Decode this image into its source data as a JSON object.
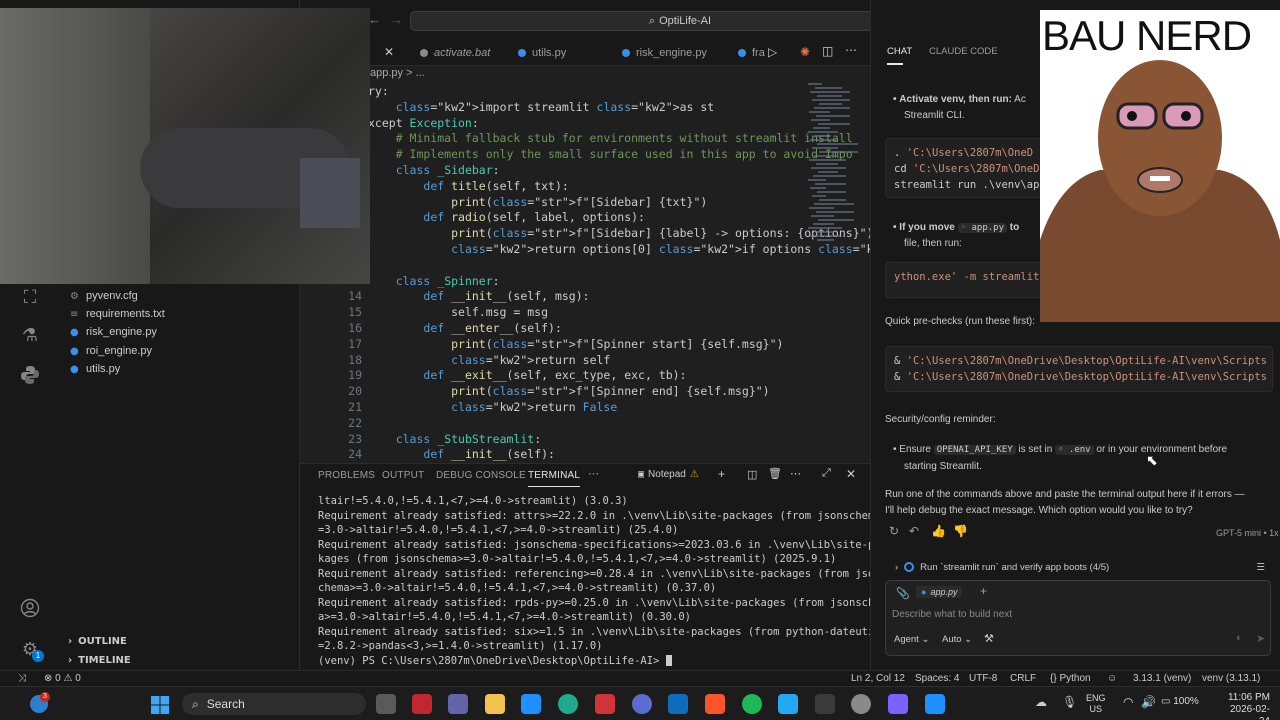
{
  "window": {
    "search_label": "OptiLife-AI",
    "breadcrumb": "app.py  > ..."
  },
  "tabs": [
    {
      "label": "activate.bat",
      "color": "#8a8a8a"
    },
    {
      "label": "utils.py",
      "color": "#3b8eea"
    },
    {
      "label": "risk_engine.py",
      "color": "#3b8eea"
    },
    {
      "label": "fra",
      "color": "#3b8eea"
    }
  ],
  "explorer": {
    "files": [
      "pyvenv.cfg",
      "requirements.txt",
      "risk_engine.py",
      "roi_engine.py",
      "utils.py"
    ],
    "outline": "OUTLINE",
    "timeline": "TIMELINE"
  },
  "editor": {
    "line_numbers": [
      "14",
      "15",
      "16",
      "17",
      "18",
      "19",
      "20",
      "21",
      "22",
      "23",
      "24"
    ],
    "lines": [
      "ry:",
      "    import streamlit as st",
      "xcept Exception:",
      "    # Minimal fallback stub for environments without streamlit install",
      "    # Implements only the small surface used in this app to avoid Impo",
      "    class _Sidebar:",
      "        def title(self, txt):",
      "            print(f\"[Sidebar] {txt}\")",
      "        def radio(self, label, options):",
      "            print(f\"[Sidebar] {label} -> options: {options}\")",
      "            return options[0] if options else None",
      "",
      "    class _Spinner:",
      "        def __init__(self, msg):",
      "            self.msg = msg",
      "        def __enter__(self):",
      "            print(f\"[Spinner start] {self.msg}\")",
      "            return self",
      "        def __exit__(self, exc_type, exc, tb):",
      "            print(f\"[Spinner end] {self.msg}\")",
      "            return False",
      "",
      "    class _StubStreamlit:",
      "        def __init__(self):"
    ]
  },
  "panel": {
    "tabs": [
      "PROBLEMS",
      "OUTPUT",
      "DEBUG CONSOLE",
      "TERMINAL"
    ],
    "active_tab": "TERMINAL",
    "terminal_name": "Notepad",
    "lines": [
      "ltair!=5.4.0,!=5.4.1,<7,>=4.0->streamlit) (3.0.3)",
      "Requirement already satisfied: attrs>=22.2.0 in .\\venv\\Lib\\site-packages (from jsonschema>",
      "=3.0->altair!=5.4.0,!=5.4.1,<7,>=4.0->streamlit) (25.4.0)",
      "Requirement already satisfied: jsonschema-specifications>=2023.03.6 in .\\venv\\Lib\\site-pac",
      "kages (from jsonschema>=3.0->altair!=5.4.0,!=5.4.1,<7,>=4.0->streamlit) (2025.9.1)",
      "Requirement already satisfied: referencing>=0.28.4 in .\\venv\\Lib\\site-packages (from jsons",
      "chema>=3.0->altair!=5.4.0,!=5.4.1,<7,>=4.0->streamlit) (0.37.0)",
      "Requirement already satisfied: rpds-py>=0.25.0 in .\\venv\\Lib\\site-packages (from jsonschem",
      "a>=3.0->altair!=5.4.0,!=5.4.1,<7,>=4.0->streamlit) (0.30.0)",
      "Requirement already satisfied: six>=1.5 in .\\venv\\Lib\\site-packages (from python-dateutil>",
      "=2.8.2->pandas<3,>=1.4.0->streamlit) (1.17.0)",
      "(venv) PS C:\\Users\\2807m\\OneDrive\\Desktop\\OptiLife-AI> "
    ]
  },
  "chat": {
    "tabs": [
      "CHAT",
      "CLAUDE CODE"
    ],
    "bullet1_bold": "Activate venv, then run:",
    "bullet1_rest": " Ac",
    "bullet1_line2": "Streamlit CLI.",
    "code1": [
      ". 'C:\\Users\\2807m\\OneD",
      "cd 'C:\\Users\\2807m\\OneD",
      "streamlit run .\\venv\\app"
    ],
    "bullet2_bold": "If you move",
    "bullet2_file": "app.py",
    "bullet2_rest": "to",
    "bullet2_line2": "file, then run:",
    "code2": "ython.exe' -m streamlit",
    "prechecks": "Quick pre-checks (run these first):",
    "code3": [
      "& 'C:\\Users\\2807m\\OneDrive\\Desktop\\OptiLife-AI\\venv\\Scripts",
      "& 'C:\\Users\\2807m\\OneDrive\\Desktop\\OptiLife-AI\\venv\\Scripts"
    ],
    "security": "Security/config reminder:",
    "ensure": "Ensure",
    "api_key": "OPENAI_API_KEY",
    "is_set_in": "is set in",
    "env_file": ".env",
    "or_in": "or in your environment before",
    "starting": "starting Streamlit.",
    "closing1": "Run one of the commands above and paste the terminal output here if it errors —",
    "closing2": "I'll help debug the exact message. Which option would you like to try?",
    "model": "GPT-5 mini • 1x",
    "task": "Run `streamlit run` and verify app boots (4/5)",
    "context_file": "app.py",
    "input_placeholder": "Describe what to build next",
    "agent_label": "Agent",
    "auto_label": "Auto"
  },
  "statusbar": {
    "errors": "0",
    "warnings": "0",
    "position": "Ln 2, Col 12",
    "spaces": "Spaces: 4",
    "encoding": "UTF-8",
    "eol": "CRLF",
    "language": "Python",
    "python_version": "3.13.1 (venv)",
    "venv": "venv (3.13.1)",
    "account_badge": "1"
  },
  "taskbar": {
    "search": "Search",
    "lang1": "ENG",
    "lang2": "US",
    "battery": "100%",
    "time": "11:06 PM",
    "date": "2026-02-24",
    "notif_badge": "3"
  },
  "overlay": {
    "avatar_title": "BAU NERD"
  }
}
